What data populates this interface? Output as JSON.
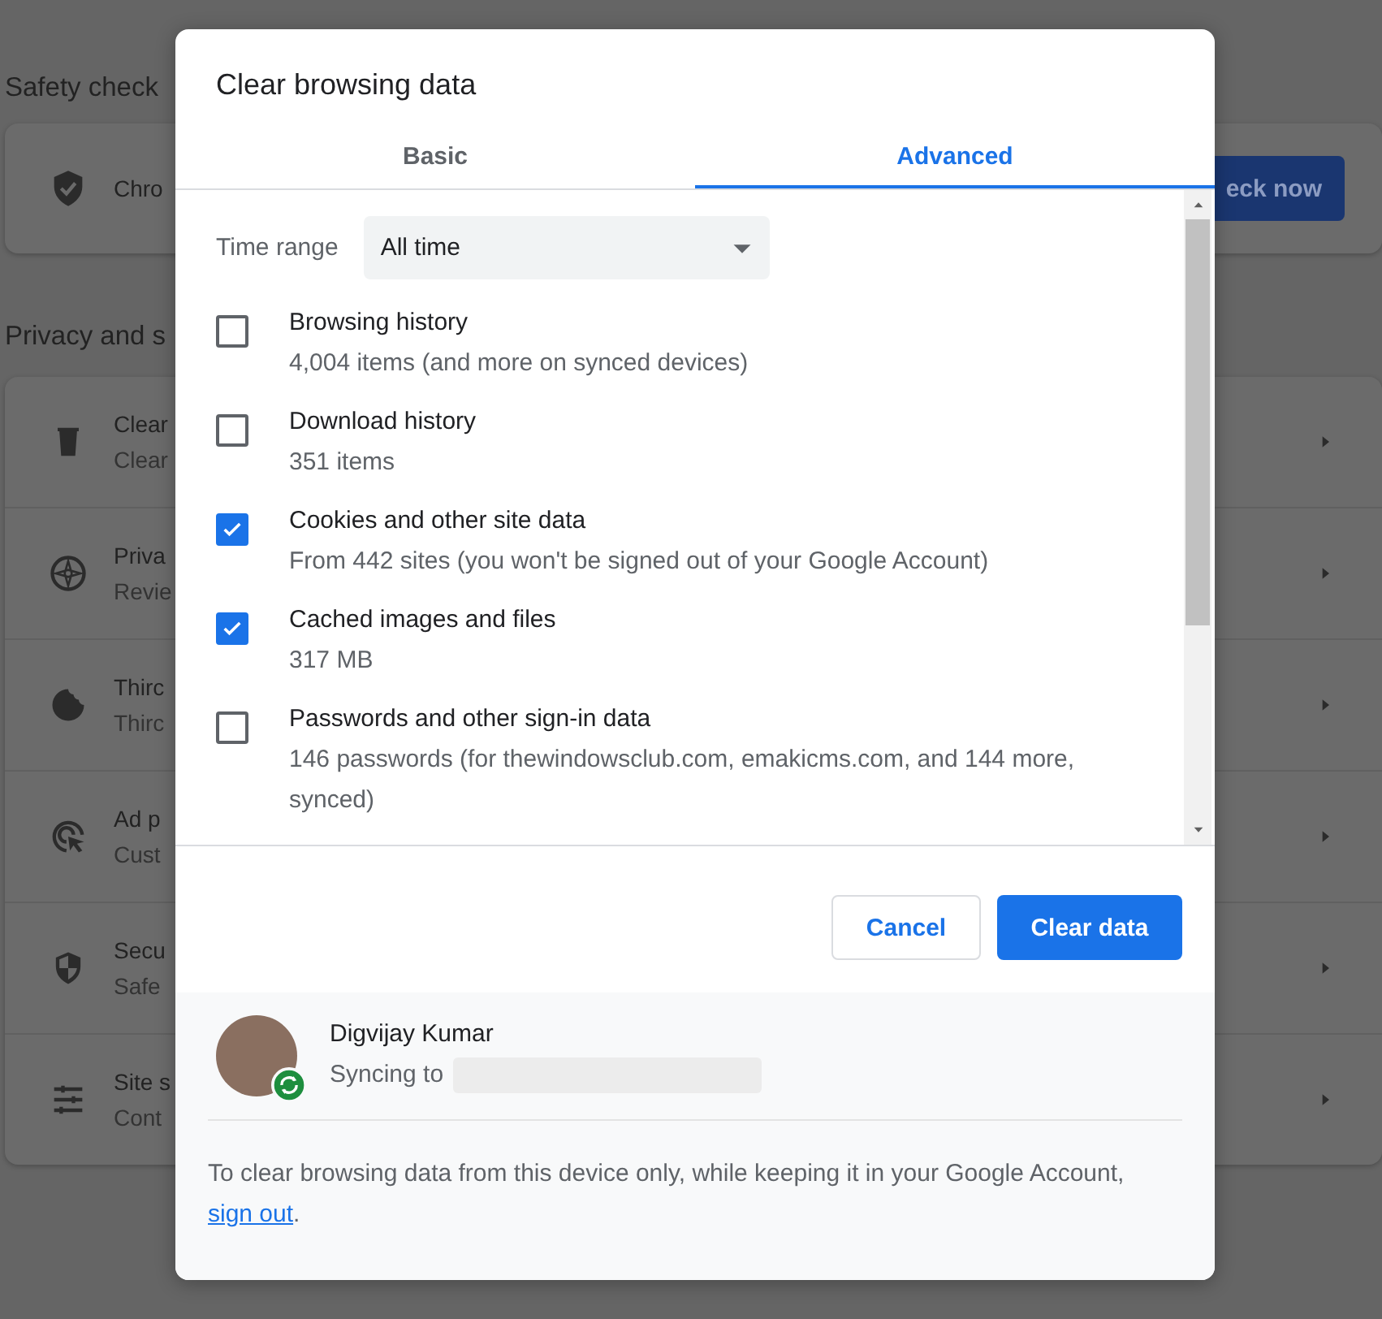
{
  "background": {
    "safety_check": {
      "heading": "Safety check",
      "item_title": "Chro",
      "button": "eck now"
    },
    "privacy": {
      "heading": "Privacy and s",
      "items": [
        {
          "kind": "trash",
          "title": "Clear",
          "subtitle": "Clear"
        },
        {
          "kind": "compass",
          "title": "Priva",
          "subtitle": "Revie"
        },
        {
          "kind": "cookie",
          "title": "Thirc",
          "subtitle": "Thirc"
        },
        {
          "kind": "target",
          "title": "Ad p",
          "subtitle": "Cust"
        },
        {
          "kind": "shield",
          "title": "Secu",
          "subtitle": "Safe"
        },
        {
          "kind": "sliders",
          "title": "Site s",
          "subtitle": "Cont"
        }
      ]
    }
  },
  "dialog": {
    "title": "Clear browsing data",
    "tabs": [
      {
        "label": "Basic",
        "selected": false
      },
      {
        "label": "Advanced",
        "selected": true
      }
    ],
    "time_range": {
      "label": "Time range",
      "value": "All time"
    },
    "options": [
      {
        "title": "Browsing history",
        "detail": "4,004 items (and more on synced devices)",
        "checked": false
      },
      {
        "title": "Download history",
        "detail": "351 items",
        "checked": false
      },
      {
        "title": "Cookies and other site data",
        "detail": "From 442 sites (you won't be signed out of your Google Account)",
        "checked": true
      },
      {
        "title": "Cached images and files",
        "detail": "317 MB",
        "checked": true
      },
      {
        "title": "Passwords and other sign-in data",
        "detail": "146 passwords (for thewindowsclub.com, emakicms.com, and 144 more, synced)",
        "checked": false
      }
    ],
    "buttons": [
      {
        "label": "Cancel",
        "kind": "secondary"
      },
      {
        "label": "Clear data",
        "kind": "primary"
      }
    ],
    "account": {
      "name": "Digvijay Kumar",
      "sync_label": "Syncing to"
    },
    "footer": {
      "text": "To clear browsing data from this device only, while keeping it in your Google Account, ",
      "link": "sign out",
      "end": "."
    }
  }
}
